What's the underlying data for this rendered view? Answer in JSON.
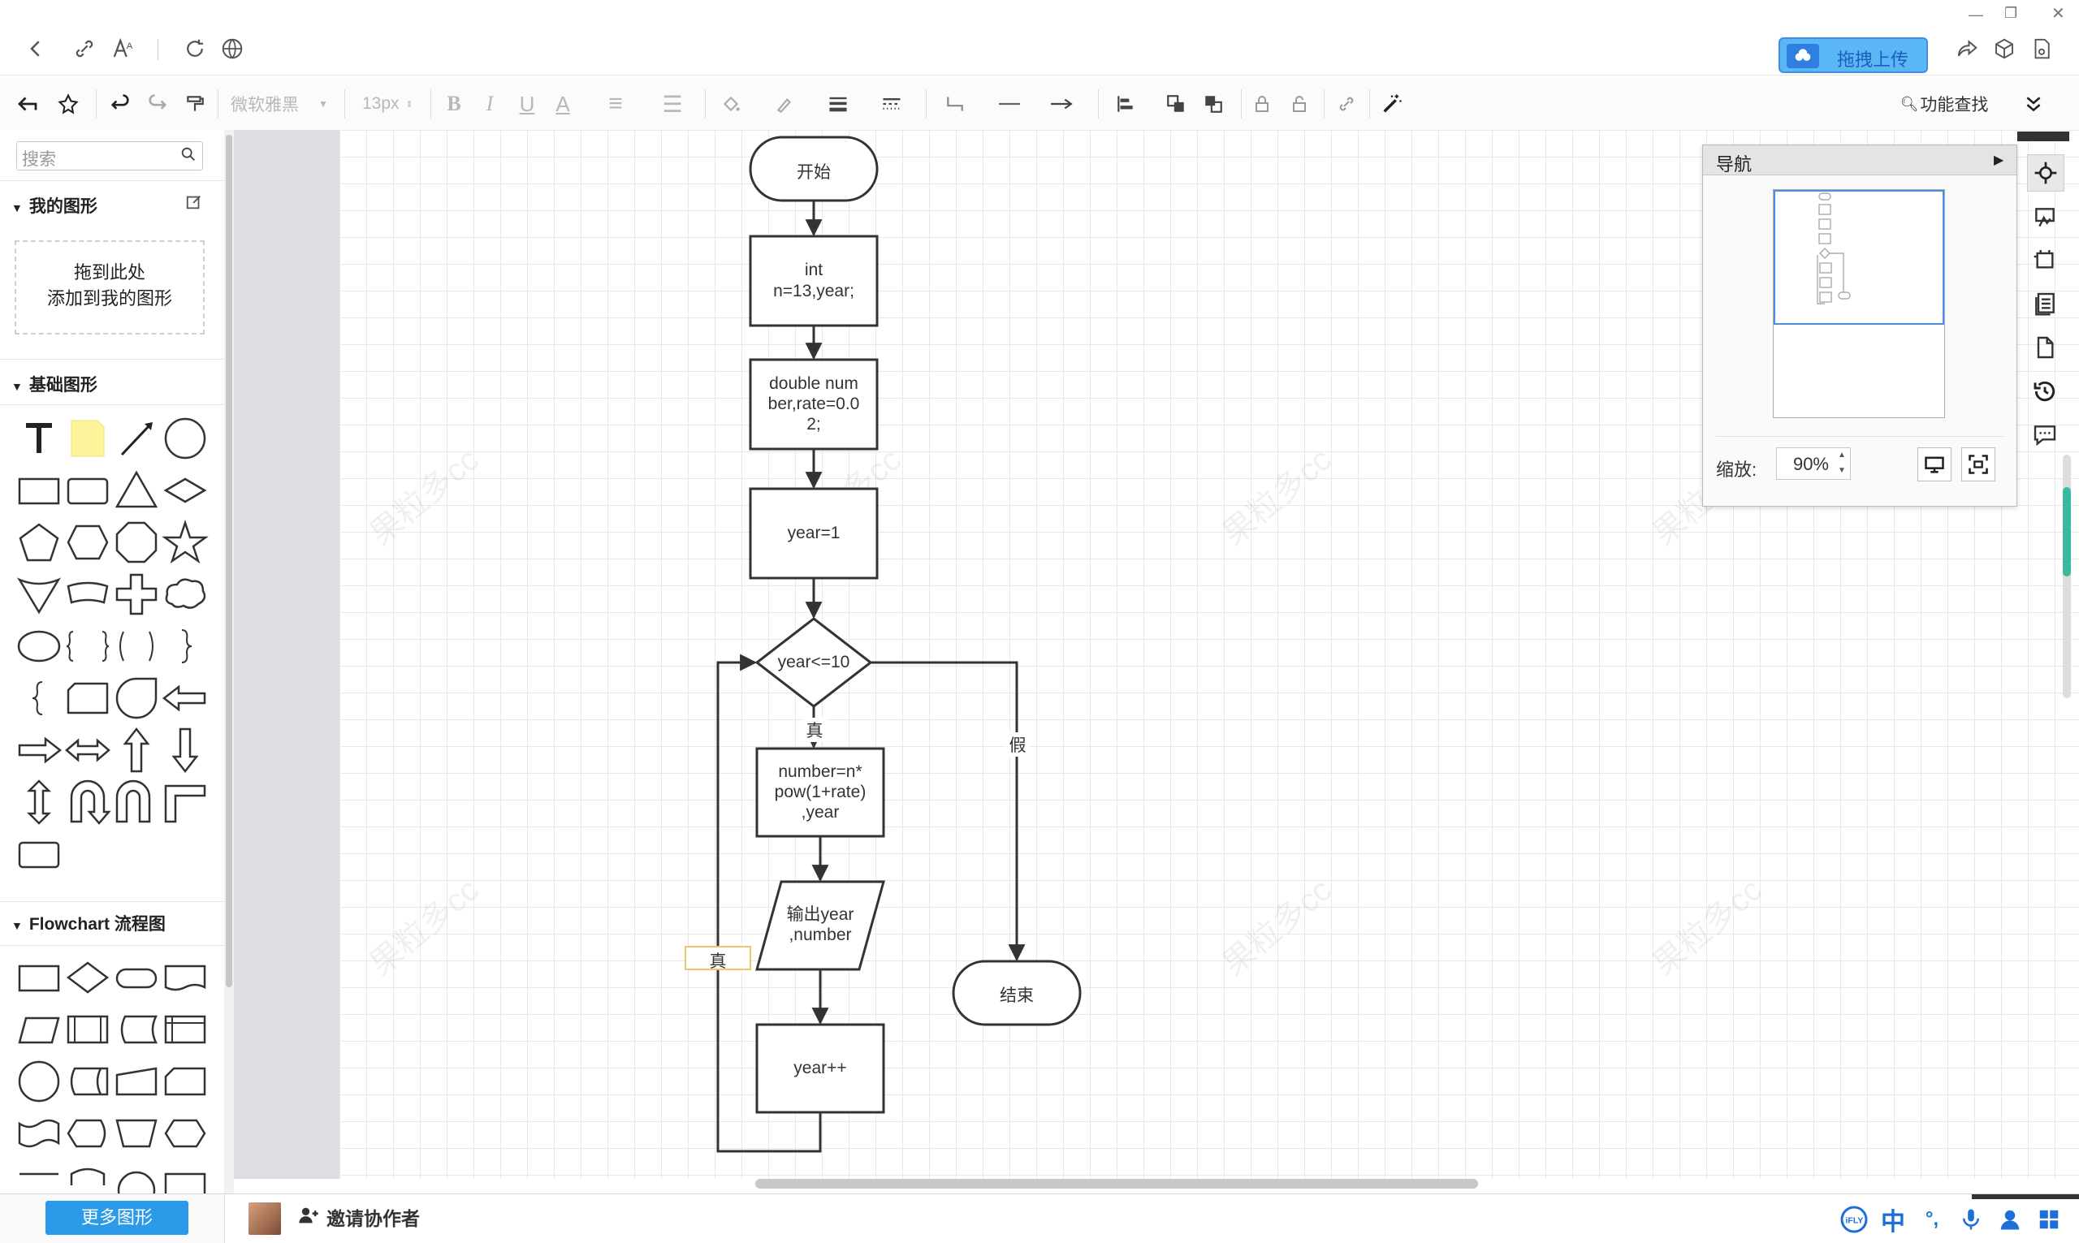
{
  "topbar": {
    "back_icon": "chevron-left-icon",
    "link_icon": "link-icon",
    "font_icon": "font-size-icon",
    "reload_icon": "reload-icon",
    "globe_icon": "globe-icon",
    "upload_label": "拖拽上传",
    "right_icons": [
      "share-icon",
      "cube-icon",
      "save-icon"
    ]
  },
  "toolbar": {
    "font_family": "微软雅黑",
    "font_size": "13px",
    "search_label": "功能查找"
  },
  "left": {
    "search_placeholder": "搜索",
    "my_shapes_title": "我的图形",
    "drop_line1": "拖到此处",
    "drop_line2": "添加到我的图形",
    "basic_title": "基础图形",
    "flowchart_title": "Flowchart 流程图"
  },
  "diagram": {
    "start": "开始",
    "init1_l1": "int",
    "init1_l2": "n=13,year;",
    "init2_l1": "double num",
    "init2_l2": "ber,rate=0.0",
    "init2_l3": "2;",
    "assign": "year=1",
    "cond": "year<=10",
    "label_true": "真",
    "label_false": "假",
    "calc_l1": "number=n*",
    "calc_l2": "pow(1+rate)",
    "calc_l3": ",year",
    "out_l1": "输出year",
    "out_l2": ",number",
    "loop_label": "真",
    "inc": "year++",
    "end": "结束"
  },
  "watermark": "果粒多cc",
  "nav": {
    "title": "导航",
    "zoom_label": "缩放:",
    "zoom_value": "90%"
  },
  "bottom": {
    "more_shapes": "更多图形",
    "invite": "邀请协作者",
    "ime_zh": "中",
    "ime_punct": "°,"
  }
}
